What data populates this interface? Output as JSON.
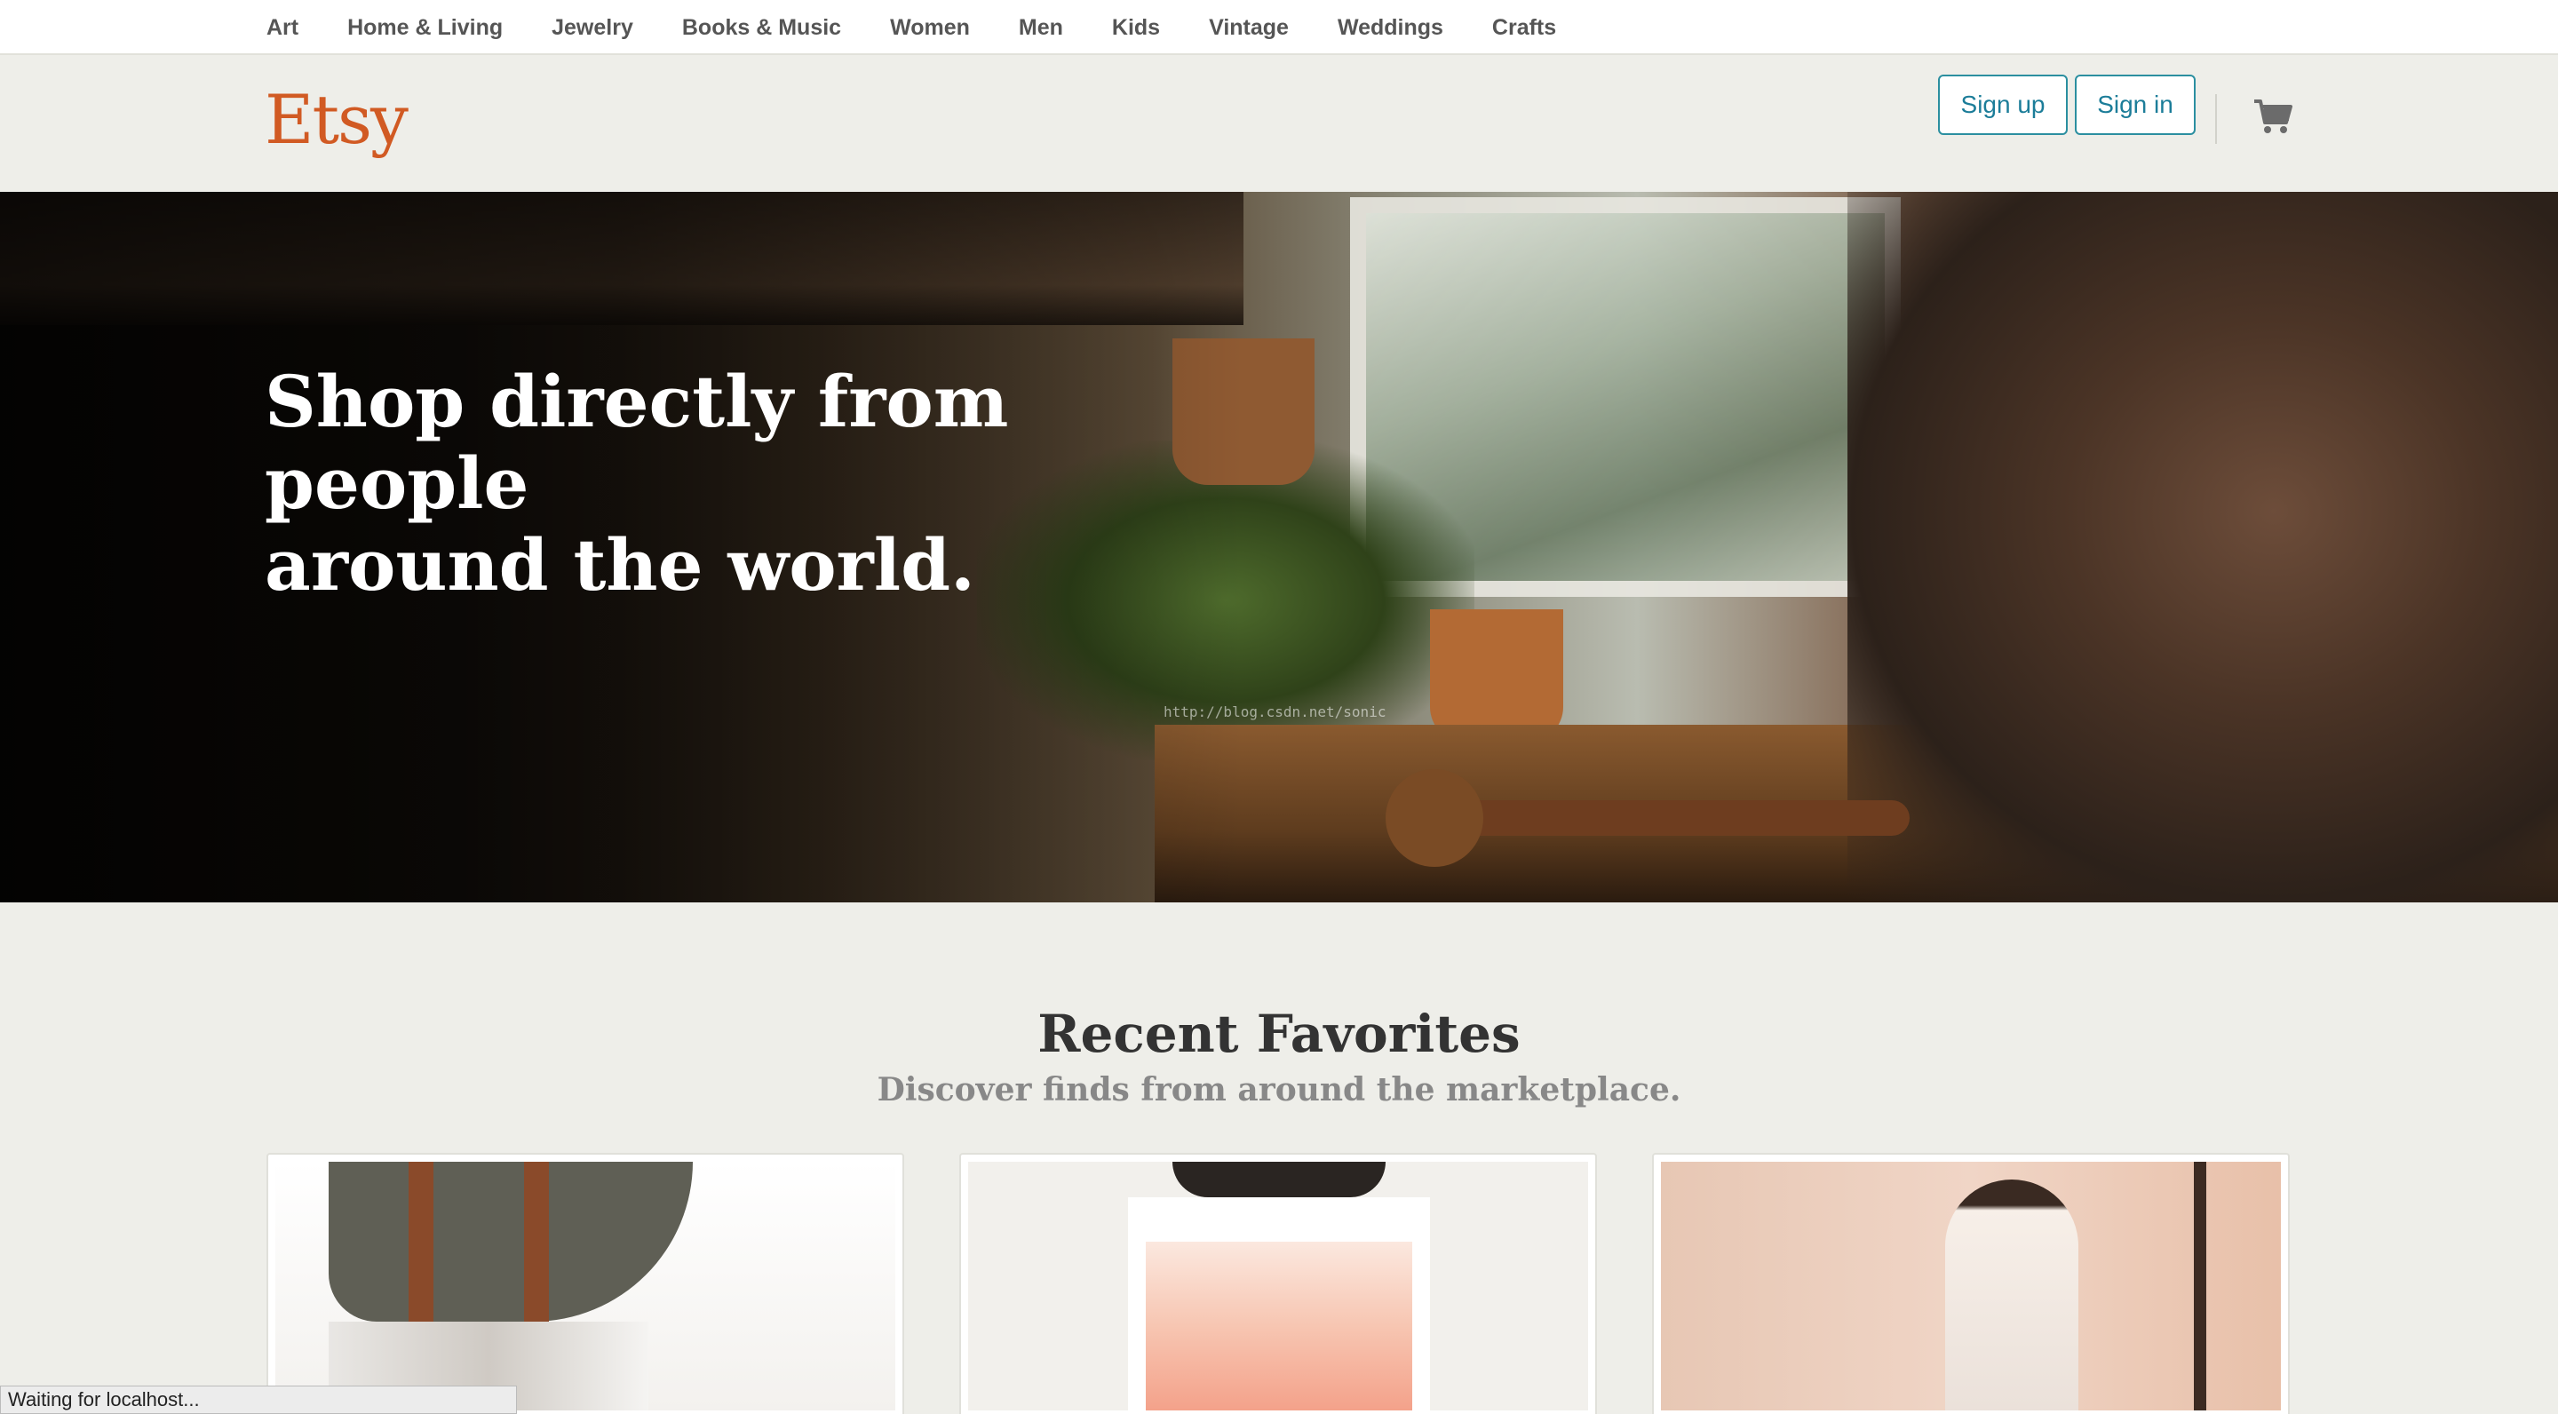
{
  "topnav": {
    "items": [
      "Art",
      "Home & Living",
      "Jewelry",
      "Books & Music",
      "Women",
      "Men",
      "Kids",
      "Vintage",
      "Weddings",
      "Crafts"
    ]
  },
  "header": {
    "logo": "Etsy",
    "signup_label": "Sign up",
    "signin_label": "Sign in",
    "cart_icon": "shopping-cart-icon"
  },
  "hero": {
    "title_line1": "Shop directly from people",
    "title_line2": "around the world.",
    "watermark": "http://blog.csdn.net/sonic"
  },
  "favorites": {
    "title": "Recent Favorites",
    "subtitle": "Discover finds from around the marketplace."
  },
  "status_bar": {
    "text": "Waiting for localhost..."
  },
  "colors": {
    "brand": "#d15a23",
    "button_border": "#2b8fa0",
    "button_text": "#1c7d99",
    "page_bg": "#eeeee9"
  }
}
